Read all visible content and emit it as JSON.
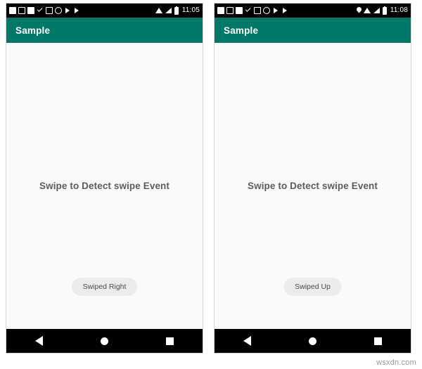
{
  "watermark": "wsxdn.com",
  "colors": {
    "appbar": "#00796b",
    "status_bar": "#000000",
    "content_bg": "#fafafa",
    "toast_bg": "#ececec",
    "hint_text": "#5c5c5c"
  },
  "phones": [
    {
      "id": "left",
      "status_bar": {
        "left_icons": [
          "video-camera-icon",
          "stop-square-icon",
          "rounded-rect-icon",
          "checkmark-icon",
          "rect-outline-icon",
          "circle-icon",
          "play-triangle-icon",
          "play-triangle-icon"
        ],
        "right_icons": [
          "wifi-icon",
          "signal-icon",
          "battery-icon"
        ],
        "time": "11:05"
      },
      "appbar": {
        "title": "Sample"
      },
      "content": {
        "hint": "Swipe to Detect swipe Event",
        "toast": "Swiped Right"
      },
      "navbar": {
        "back_label": "Back",
        "home_label": "Home",
        "recents_label": "Recents"
      }
    },
    {
      "id": "right",
      "status_bar": {
        "left_icons": [
          "video-camera-icon",
          "stop-square-icon",
          "rounded-rect-icon",
          "checkmark-icon",
          "rect-outline-icon",
          "circle-icon",
          "play-triangle-icon",
          "play-triangle-icon"
        ],
        "right_icons": [
          "location-pin-icon",
          "wifi-icon",
          "signal-icon",
          "battery-icon"
        ],
        "time": "11:08"
      },
      "appbar": {
        "title": "Sample"
      },
      "content": {
        "hint": "Swipe to Detect swipe Event",
        "toast": "Swiped Up"
      },
      "navbar": {
        "back_label": "Back",
        "home_label": "Home",
        "recents_label": "Recents"
      }
    }
  ]
}
